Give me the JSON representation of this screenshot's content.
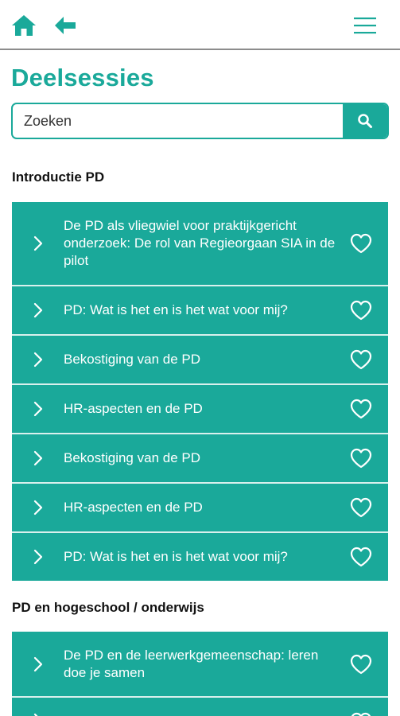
{
  "header": {
    "home_icon": "home-icon",
    "back_icon": "arrow-left-icon",
    "menu_icon": "hamburger-menu-icon"
  },
  "page": {
    "title": "Deelsessies"
  },
  "search": {
    "placeholder": "Zoeken",
    "icon": "search-icon"
  },
  "colors": {
    "accent": "#1aa99a",
    "divider": "#d9f0ed"
  },
  "sections": [
    {
      "heading": "Introductie PD",
      "items": [
        {
          "label": "De PD als vliegwiel voor praktijkgericht onderzoek: De rol van Regieorgaan SIA in de pilot"
        },
        {
          "label": "PD: Wat is het en is het wat voor mij?"
        },
        {
          "label": "Bekostiging van de PD"
        },
        {
          "label": "HR-aspecten en de PD"
        },
        {
          "label": "Bekostiging van de PD"
        },
        {
          "label": "HR-aspecten en de PD"
        },
        {
          "label": "PD: Wat is het en is het wat voor mij?"
        }
      ]
    },
    {
      "heading": "PD en hogeschool / onderwijs",
      "items": [
        {
          "label": "De PD en de leerwerkgemeenschap: leren doe je samen"
        },
        {
          "label": ""
        }
      ]
    }
  ]
}
